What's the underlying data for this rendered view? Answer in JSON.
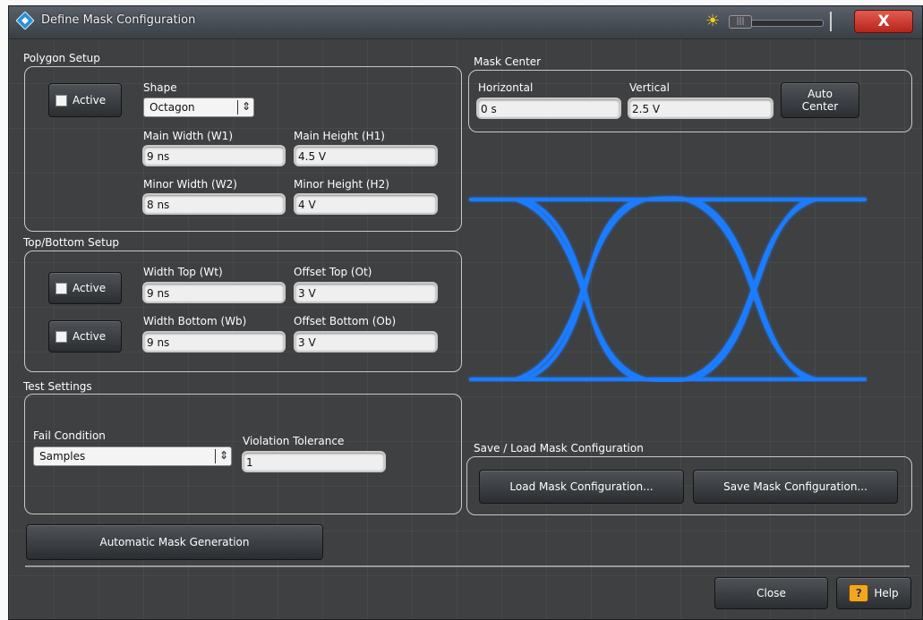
{
  "window": {
    "title": "Define Mask Configuration"
  },
  "polygon_setup": {
    "label": "Polygon Setup",
    "active_label": "Active",
    "shape_label": "Shape",
    "shape_value": "Octagon",
    "main_width_label": "Main Width (W1)",
    "main_width_value": "9 ns",
    "main_height_label": "Main Height (H1)",
    "main_height_value": "4.5 V",
    "minor_width_label": "Minor Width (W2)",
    "minor_width_value": "8 ns",
    "minor_height_label": "Minor Height (H2)",
    "minor_height_value": "4 V"
  },
  "top_bottom_setup": {
    "label": "Top/Bottom Setup",
    "active_top_label": "Active",
    "active_bottom_label": "Active",
    "width_top_label": "Width Top (Wt)",
    "width_top_value": "9 ns",
    "offset_top_label": "Offset Top (Ot)",
    "offset_top_value": "3 V",
    "width_bottom_label": "Width Bottom (Wb)",
    "width_bottom_value": "9 ns",
    "offset_bottom_label": "Offset Bottom (Ob)",
    "offset_bottom_value": "3 V"
  },
  "test_settings": {
    "label": "Test Settings",
    "fail_condition_label": "Fail Condition",
    "fail_condition_value": "Samples",
    "violation_tolerance_label": "Violation Tolerance",
    "violation_tolerance_value": "1"
  },
  "mask_center": {
    "label": "Mask Center",
    "horizontal_label": "Horizontal",
    "horizontal_value": "0 s",
    "vertical_label": "Vertical",
    "vertical_value": "2.5 V",
    "auto_center_line1": "Auto",
    "auto_center_line2": "Center"
  },
  "save_load": {
    "label": "Save / Load Mask Configuration",
    "load_button": "Load Mask Configuration...",
    "save_button": "Save Mask Configuration..."
  },
  "automatic_mask_button": "Automatic Mask Generation",
  "footer": {
    "close_button": "Close",
    "help_button": "Help"
  },
  "icons": {
    "logo": "rohde-schwarz-diamond-icon",
    "brightness": "sun-icon",
    "close": "close-x-icon",
    "help": "help-question-icon"
  },
  "colors": {
    "eye_diagram": "#1e7bff",
    "close_button": "#c83a2f",
    "help_icon": "#f1a623"
  }
}
